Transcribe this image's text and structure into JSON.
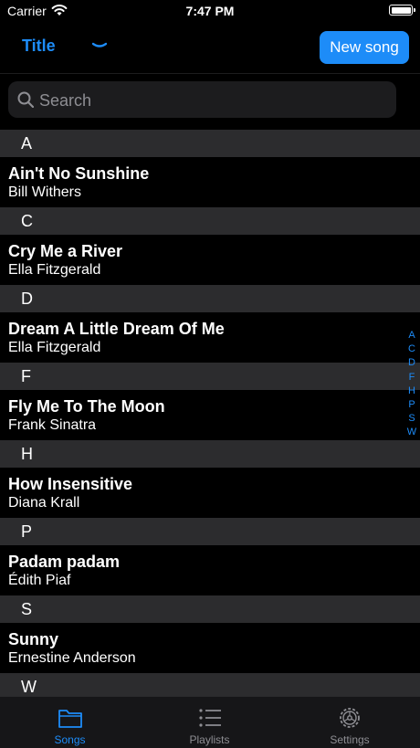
{
  "status_bar": {
    "carrier": "Carrier",
    "time": "7:47 PM"
  },
  "nav": {
    "sort_label": "Title",
    "new_song_label": "New song"
  },
  "search": {
    "placeholder": "Search"
  },
  "sections": [
    {
      "letter": "A",
      "songs": [
        {
          "title": "Ain't No Sunshine",
          "artist": "Bill Withers"
        }
      ]
    },
    {
      "letter": "C",
      "songs": [
        {
          "title": "Cry Me a River",
          "artist": "Ella Fitzgerald"
        }
      ]
    },
    {
      "letter": "D",
      "songs": [
        {
          "title": "Dream A Little Dream Of Me",
          "artist": "Ella Fitzgerald"
        }
      ]
    },
    {
      "letter": "F",
      "songs": [
        {
          "title": "Fly Me To The Moon",
          "artist": "Frank Sinatra"
        }
      ]
    },
    {
      "letter": "H",
      "songs": [
        {
          "title": "How Insensitive",
          "artist": "Diana Krall"
        }
      ]
    },
    {
      "letter": "P",
      "songs": [
        {
          "title": "Padam padam",
          "artist": "Édith Piaf"
        }
      ]
    },
    {
      "letter": "S",
      "songs": [
        {
          "title": "Sunny",
          "artist": "Ernestine Anderson"
        }
      ]
    },
    {
      "letter": "W",
      "songs": []
    }
  ],
  "index_letters": [
    "A",
    "C",
    "D",
    "F",
    "H",
    "P",
    "S",
    "W"
  ],
  "tabs": [
    {
      "label": "Songs",
      "icon": "folder-icon",
      "active": true
    },
    {
      "label": "Playlists",
      "icon": "list-icon",
      "active": false
    },
    {
      "label": "Settings",
      "icon": "gear-icon",
      "active": false
    }
  ],
  "colors": {
    "accent": "#1d8cf8",
    "background": "#000000",
    "section_header": "#2c2c2e",
    "tab_inactive": "#8e8e93"
  }
}
